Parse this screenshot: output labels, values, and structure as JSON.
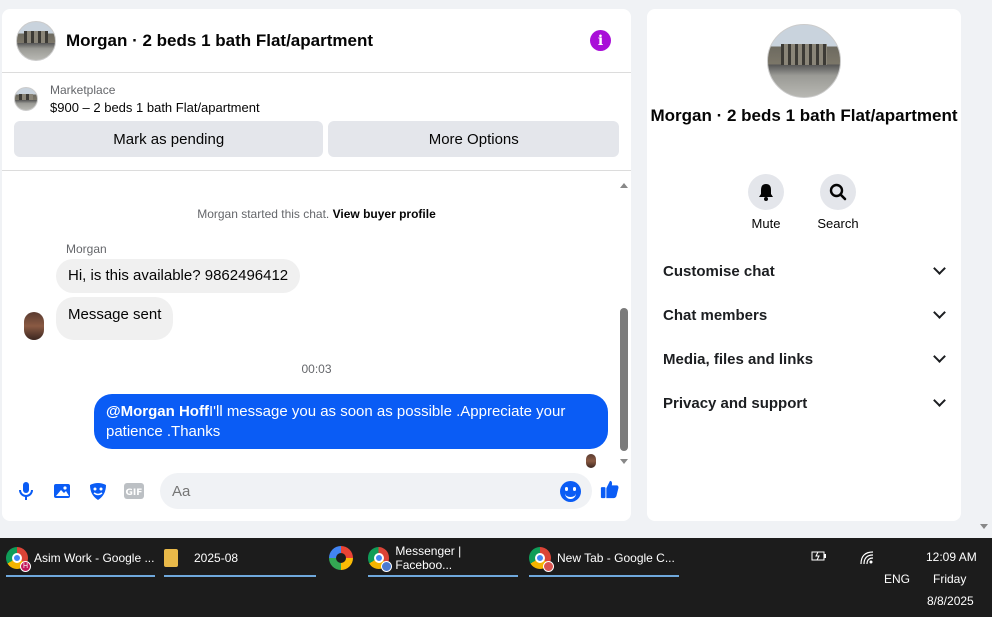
{
  "chat": {
    "title": "Morgan · 2 beds 1 bath Flat/apartment",
    "listing": {
      "source": "Marketplace",
      "price_title": "$900 – 2 beds 1 bath Flat/apartment",
      "mark_pending": "Mark as pending",
      "more_options": "More Options"
    },
    "system_line": "Morgan started this chat.",
    "system_link": "View buyer profile",
    "sender_name": "Morgan",
    "messages_in": [
      "Hi, is this available? 9862496412",
      "Message sent"
    ],
    "timestamp": "00:03",
    "message_out_mention": "@Morgan Hoff",
    "message_out_text": "I'll message you as soon as possible .Appreciate your patience .Thanks",
    "composer_placeholder": "Aa"
  },
  "side": {
    "title": "Morgan · 2 beds 1 bath Flat/apartment",
    "actions": [
      "Mute",
      "Search"
    ],
    "sections": [
      "Customise chat",
      "Chat members",
      "Media, files and links",
      "Privacy and support"
    ]
  },
  "taskbar": {
    "items": [
      "Asim Work - Google ...",
      "2025-08",
      "Messenger | Faceboo...",
      "New Tab - Google C..."
    ],
    "badges": [
      "H",
      "",
      "",
      ""
    ],
    "lang": "ENG",
    "time": "12:09 AM",
    "day": "Friday",
    "date": "8/8/2025"
  },
  "colors": {
    "accent": "#0a5cf5",
    "info": "#a90ed8",
    "taskbar": "#1c1c1c"
  }
}
